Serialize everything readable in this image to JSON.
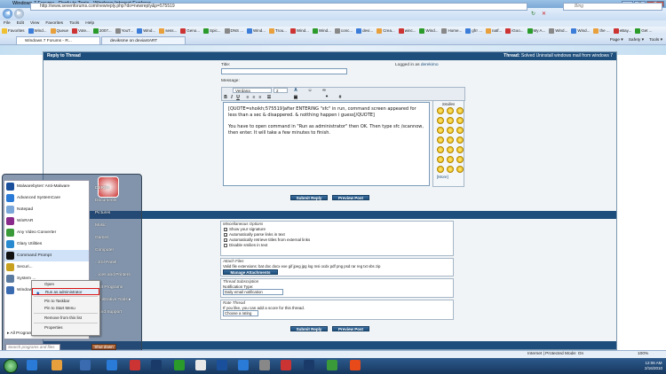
{
  "window": {
    "title": "Windows 7 Forums - Reply to Topic - Windows Internet Explorer",
    "min": "–",
    "max": "□",
    "close": "✕"
  },
  "address": {
    "url": "http://www.sevenforums.com/newreply.php?do=newreply&p=575519",
    "search_placeholder": "Bing"
  },
  "menu": [
    "File",
    "Edit",
    "View",
    "Favorites",
    "Tools",
    "Help"
  ],
  "favorites": {
    "label": "Favorites",
    "items": [
      "Wind...",
      "Queue",
      "Vote...",
      "2007...",
      "YouT...",
      "Wind...",
      "sess...",
      "Geno...",
      "Spic...",
      "DNS ...",
      "Wind...",
      "Trou...",
      "Wind...",
      "Wind...",
      "conc...",
      "devi...",
      "Crea...",
      "winc...",
      "Wind...",
      "Home...",
      "gfrr ...",
      "natf...",
      "iGoo...",
      "My A...",
      "Wind...",
      "Wind...",
      "the ...",
      "eBay...",
      "Get ..."
    ]
  },
  "tabs": [
    "Windows 7 Forums - R...",
    "deviksme on deviantART"
  ],
  "commands": [
    "Page ▾",
    "Safety ▾",
    "Tools ▾"
  ],
  "form": {
    "header": "Reply to Thread",
    "thread_label": "Thread:",
    "thread_title": "Solved Uninstall windows mail from windows 7",
    "title_label": "Title:",
    "logged_in_label": "Logged in as",
    "logged_in_user": "derekimo",
    "message_label": "Message:",
    "font_name": "Verdana",
    "font_size": "2",
    "editor_text_1": "[QUOTE=shoikh;575519]after ENTERING \"sfc\" in run, command screen appeared for less than a sec & disappered. & notthing happen i guess[/QUOTE]",
    "editor_text_2": "You have to open command in \"Run as administrator\" then OK. Then type sfc /scannow, then enter. It will take a few minutes to finish.",
    "smilies_label": "Smilies",
    "smilies_more": "[More]",
    "submit": "Submit Reply",
    "preview": "Preview Post"
  },
  "options": {
    "misc_title": "Miscellaneous Options",
    "opt1": "Show your signature",
    "opt2": "Automatically parse links in text",
    "opt3": "Automatically retrieve titles from external links",
    "opt4": "Disable smilies in text",
    "attach_title": "Attach Files",
    "attach_text": "Valid file extensions: bat doc docx exe gif jpeg jpg log msi ocdx pdf png psd rar reg txt vbs zip",
    "attach_button": "Manage Attachments",
    "sub_title": "Thread Subscription",
    "sub_label": "Notification Type:",
    "sub_value": "Daily email notification",
    "rate_title": "Rate Thread",
    "rate_text": "If you like, you can add a score for this thread.",
    "rate_value": "Choose a rating"
  },
  "start_menu": {
    "left": [
      "Malwarebytes' Anti-Malware",
      "Advanced SystemCare",
      "Notepad",
      "WinRAR",
      "Any Video Converter",
      "Glary Utilities",
      "Command Prompt",
      "Securi...",
      "System ...",
      "Window..."
    ],
    "all_programs": "All Programs",
    "search_placeholder": "Search programs and files",
    "shutdown": "Shut down",
    "right": [
      "DEREK",
      "Documents",
      "Pictures",
      "Music",
      "Games",
      "Computer",
      "...trol Panel",
      "...ices and Printers",
      "...ult Programs",
      "...inistrative Tools ▸",
      "...and Support"
    ]
  },
  "context_menu": {
    "items": [
      "Open",
      "Run as administrator",
      "Pin to Taskbar",
      "Pin to Start Menu",
      "Remove from this list",
      "Properties"
    ]
  },
  "status": {
    "zone": "Internet | Protected Mode: On",
    "zoom": "100%"
  },
  "tray": {
    "time": "12:06 AM",
    "date": "2/16/2010"
  }
}
